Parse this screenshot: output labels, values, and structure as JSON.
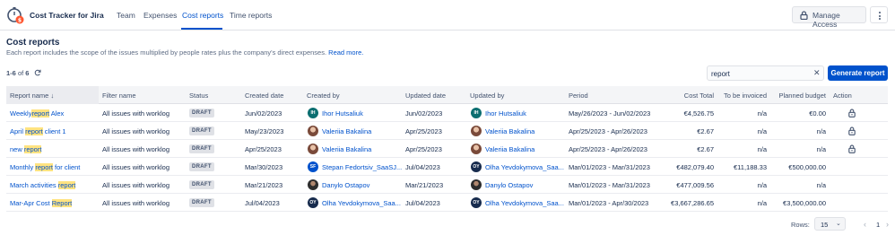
{
  "app": {
    "title": "Cost Tracker for Jira",
    "accent": "#0052cc"
  },
  "nav": [
    {
      "label": "Team",
      "active": false
    },
    {
      "label": "Expenses",
      "active": false
    },
    {
      "label": "Cost reports",
      "active": true
    },
    {
      "label": "Time reports",
      "active": false
    }
  ],
  "header": {
    "manage_label": "Manage Access",
    "lock_icon": "lock-icon",
    "more_icon": "more-vertical-icon"
  },
  "page": {
    "title": "Cost reports",
    "description": "Each report includes the scope of the issues multiplied by people rates plus the company's direct expenses.",
    "read_more": "Read more."
  },
  "toolbar": {
    "count_range": "1-6",
    "count_of": "of",
    "count_total": "6",
    "search_value": "report",
    "generate_label": "Generate report"
  },
  "table": {
    "columns": [
      "Report name",
      "Filter name",
      "Status",
      "Created date",
      "Created by",
      "Updated date",
      "Updated by",
      "Period",
      "Cost Total",
      "To be invoiced",
      "Planned budget",
      "Action"
    ],
    "sort_indicator": "↓",
    "rows": [
      {
        "name_pre": "Weekly",
        "name_hl": "report",
        "name_post": " Alex",
        "filter": "All issues with worklog",
        "status": "DRAFT",
        "created_date": "Jun/02/2023",
        "created_by": "Ihor Hutsaliuk",
        "created_avatar": "IH",
        "updated_date": "Jun/02/2023",
        "updated_by": "Ihor Hutsaliuk",
        "updated_avatar": "IH",
        "period": "May/26/2023 - Jun/02/2023",
        "cost_total": "€4,526.75",
        "to_be_invoiced": "n/a",
        "planned_budget": "€0.00",
        "lock": true
      },
      {
        "name_pre": "April ",
        "name_hl": "report",
        "name_post": " client 1",
        "filter": "All issues with worklog",
        "status": "DRAFT",
        "created_date": "May/23/2023",
        "created_by": "Valeriia Bakalina",
        "created_avatar": "",
        "updated_date": "Apr/25/2023",
        "updated_by": "Valeriia Bakalina",
        "updated_avatar": "",
        "period": "Apr/25/2023 - Apr/26/2023",
        "cost_total": "€2.67",
        "to_be_invoiced": "n/a",
        "planned_budget": "n/a",
        "lock": true
      },
      {
        "name_pre": "new ",
        "name_hl": "report",
        "name_post": "",
        "filter": "All issues with worklog",
        "status": "DRAFT",
        "created_date": "Apr/25/2023",
        "created_by": "Valeriia Bakalina",
        "created_avatar": "",
        "updated_date": "Apr/25/2023",
        "updated_by": "Valeriia Bakalina",
        "updated_avatar": "",
        "period": "Apr/25/2023 - Apr/26/2023",
        "cost_total": "€2.67",
        "to_be_invoiced": "n/a",
        "planned_budget": "n/a",
        "lock": true
      },
      {
        "name_pre": "Monthly ",
        "name_hl": "report",
        "name_post": " for client",
        "filter": "All issues with worklog",
        "status": "DRAFT",
        "created_date": "Mar/30/2023",
        "created_by": "Stepan Fedortsiv_SaaSJ...",
        "created_avatar": "SF",
        "updated_date": "Jul/04/2023",
        "updated_by": "Olha Yevdokymova_Saa...",
        "updated_avatar": "OY",
        "period": "Mar/01/2023 - Mar/31/2023",
        "cost_total": "€482,079.40",
        "to_be_invoiced": "€11,188.33",
        "planned_budget": "€500,000.00",
        "lock": false
      },
      {
        "name_pre": "March activities ",
        "name_hl": "report",
        "name_post": "",
        "filter": "All issues with worklog",
        "status": "DRAFT",
        "created_date": "Mar/21/2023",
        "created_by": "Danylo Ostapov",
        "created_avatar": "",
        "updated_date": "Mar/21/2023",
        "updated_by": "Danylo Ostapov",
        "updated_avatar": "",
        "period": "Mar/01/2023 - Mar/31/2023",
        "cost_total": "€477,009.56",
        "to_be_invoiced": "n/a",
        "planned_budget": "n/a",
        "lock": false
      },
      {
        "name_pre": "Mar-Apr Cost ",
        "name_hl": "Report",
        "name_post": "",
        "filter": "All issues with worklog",
        "status": "DRAFT",
        "created_date": "Jul/04/2023",
        "created_by": "Olha Yevdokymova_Saa...",
        "created_avatar": "OY",
        "updated_date": "Jul/04/2023",
        "updated_by": "Olha Yevdokymova_Saa...",
        "updated_avatar": "OY",
        "period": "Mar/01/2023 - Apr/30/2023",
        "cost_total": "€3,667,286.65",
        "to_be_invoiced": "n/a",
        "planned_budget": "€3,500,000.00",
        "lock": false
      }
    ]
  },
  "footer": {
    "rows_label": "Rows:",
    "rows_value": "15",
    "page": "1"
  }
}
